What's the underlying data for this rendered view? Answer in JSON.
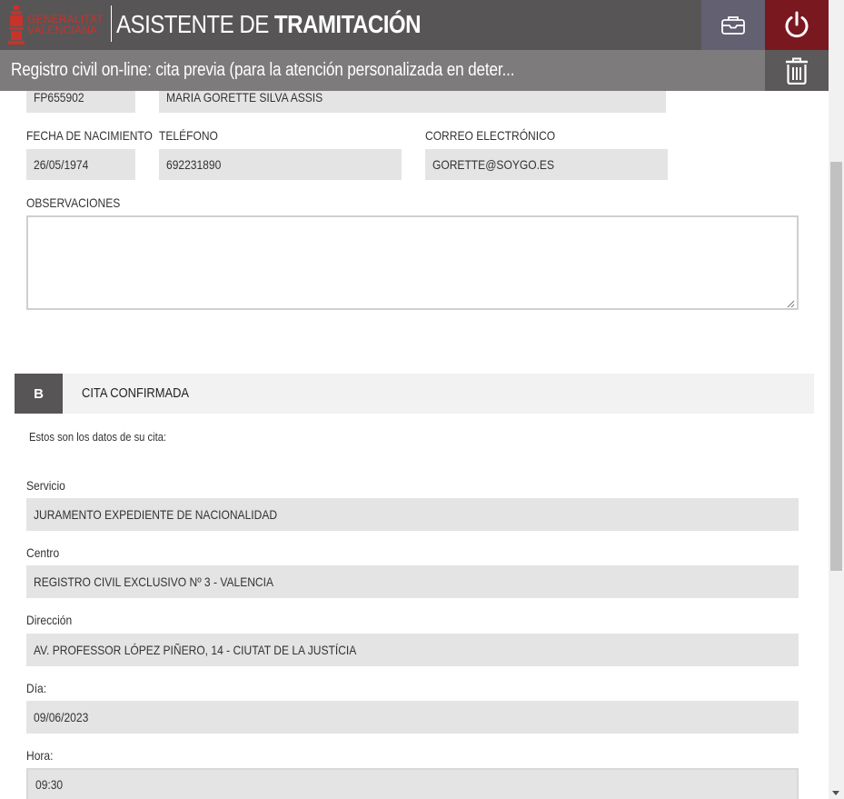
{
  "header": {
    "logo_line1": "GENERALITAT",
    "logo_line2": "VALENCIANA",
    "title_light": "ASISTENTE DE ",
    "title_bold": "TRAMITACIÓN",
    "procedure_title": "Registro civil on-line: cita previa (para la atención personalizada en deter..."
  },
  "personal": {
    "document": "FP655902",
    "full_name": "MARIA GORETTE SILVA ASSIS",
    "birth_date_label": "FECHA DE NACIMIENTO",
    "birth_date": "26/05/1974",
    "phone_label": "TELÉFONO",
    "phone": "692231890",
    "email_label": "CORREO ELECTRÓNICO",
    "email": "GORETTE@SOYGO.ES",
    "observations_label": "OBSERVACIONES",
    "observations": ""
  },
  "section_b": {
    "letter": "B",
    "title": "CITA CONFIRMADA",
    "intro": "Estos son los datos de su cita:",
    "servicio_label": "Servicio",
    "servicio": "JURAMENTO EXPEDIENTE DE NACIONALIDAD",
    "centro_label": "Centro",
    "centro": "REGISTRO CIVIL EXCLUSIVO Nº 3 - VALENCIA",
    "direccion_label": "Dirección",
    "direccion": "AV. PROFESSOR LÓPEZ PIÑERO, 14 - CIUTAT DE LA JUSTÍCIA",
    "dia_label": "Día:",
    "dia": "09/06/2023",
    "hora_label": "Hora:",
    "hora": "09:30"
  },
  "icons": {
    "inbox": "inbox-icon",
    "power": "power-icon",
    "trash": "trash-icon"
  },
  "colors": {
    "header_bg": "#585556",
    "subheader_bg": "#7d7b7c",
    "power_bg": "#7a1820",
    "brand_red": "#c8322a",
    "field_bg": "#e4e4e4"
  }
}
